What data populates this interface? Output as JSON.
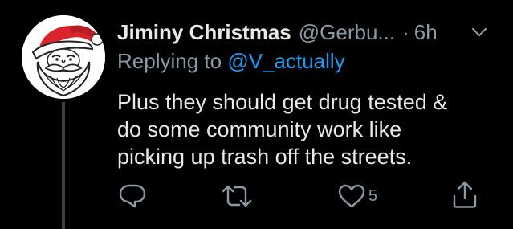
{
  "tweet": {
    "display_name": "Jiminy Christmas",
    "handle": "@Gerbu...",
    "separator": "·",
    "time": "6h",
    "replying_prefix": "Replying to",
    "replying_to": "@V_actually",
    "body_lines": [
      "Plus they should get drug tested &",
      "do some community work like",
      "picking up trash off the streets."
    ],
    "avatar_icon": "santa-claus-avatar",
    "colors": {
      "background": "#000000",
      "text": "#e7e9ea",
      "muted": "#8b98a5",
      "link": "#1d9bf0",
      "thread_line": "#3d4145"
    }
  },
  "actions": {
    "reply_icon": "reply-icon",
    "retweet_icon": "retweet-icon",
    "like_icon": "heart-icon",
    "like_count": "5",
    "share_icon": "share-icon"
  }
}
